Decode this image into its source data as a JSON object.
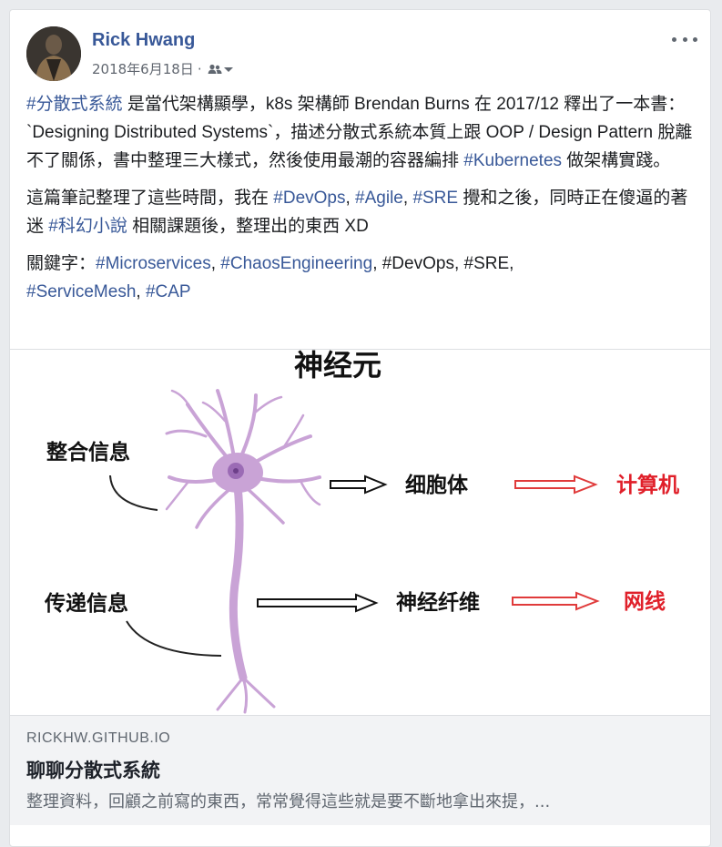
{
  "post": {
    "author": "Rick Hwang",
    "date": "2018年6月18日",
    "separator": "·",
    "audience_icon": "friends-icon",
    "menu_icon": "more-options-icon",
    "paragraph1": {
      "hashtag1": "#分散式系統",
      "text1": " 是當代架構顯學，k8s 架構師 Brendan Burns 在 2017/12 釋出了一本書：`Designing Distributed Systems`，描述分散式系統本質上跟 OOP / Design Pattern 脫離不了關係，書中整理三大樣式，然後使用最潮的容器編排 ",
      "hashtag2": "#Kubernetes",
      "text2": " 做架構實踐。"
    },
    "paragraph2": {
      "text1": "這篇筆記整理了這些時間，我在 ",
      "hashtag_devops": "#DevOps",
      "comma1": ", ",
      "hashtag_agile": "#Agile",
      "comma2": ", ",
      "hashtag_sre": "#SRE",
      "text2": " 攪和之後，同時正在傻逼的著迷 ",
      "hashtag_scifi": "#科幻小說",
      "text3": " 相關課題後，整理出的東西 XD"
    },
    "paragraph3": {
      "label": "關鍵字：",
      "hashtag_micro": "#Microservices",
      "comma1": ", ",
      "hashtag_chaos": "#ChaosEngineering",
      "plain": ", #DevOps, #SRE,",
      "hashtag_mesh": "#ServiceMesh",
      "comma2": ", ",
      "hashtag_cap": "#CAP"
    }
  },
  "image": {
    "title": "神经元",
    "label_integrate": "整合信息",
    "label_transmit": "传递信息",
    "label_cell_body": "细胞体",
    "label_fiber": "神经纤维",
    "label_computer": "计算机",
    "label_network": "网线",
    "colors": {
      "neuron": "#c9a3d6",
      "nucleus": "#9b6bb5",
      "arrow_red": "#e03b3b",
      "text_red": "#e0202a"
    }
  },
  "link_preview": {
    "domain": "RICKHW.GITHUB.IO",
    "title": "聊聊分散式系統",
    "description": "整理資料，回顧之前寫的東西，常常覺得這些就是要不斷地拿出來提，..."
  }
}
